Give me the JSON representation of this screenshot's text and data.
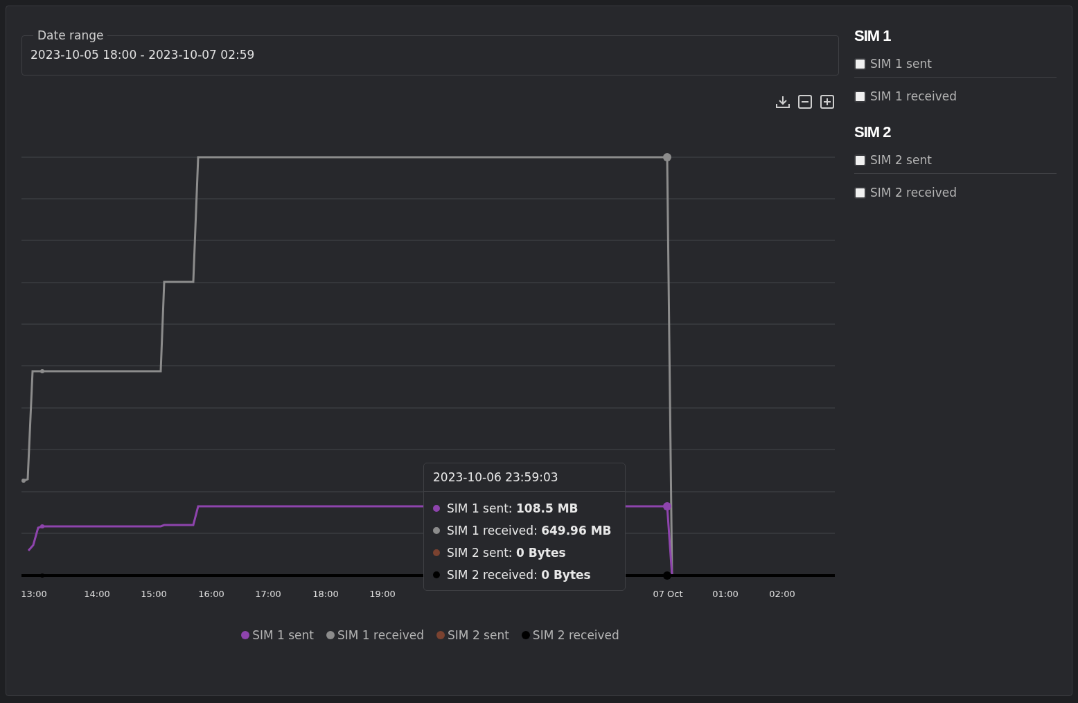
{
  "date_range": {
    "label": "Date range",
    "value": "2023-10-05 18:00 - 2023-10-07 02:59"
  },
  "chart": {
    "x_tick_labels": [
      "13:00",
      "14:00",
      "15:00",
      "16:00",
      "17:00",
      "18:00",
      "19:00",
      "07 Oct",
      "01:00",
      "02:00"
    ]
  },
  "tooltip": {
    "title": "2023-10-06 23:59:03",
    "items": [
      {
        "text": "SIM 1 sent: **108.5 MB**",
        "color": "#8e44ad"
      },
      {
        "text": "SIM 1 received: **649.96 MB**",
        "color": "#8c8c8c"
      },
      {
        "text": "SIM 2 sent: **0 Bytes**",
        "color": "#7a4230"
      },
      {
        "text": "SIM 2 received: **0 Bytes**",
        "color": "#000000"
      }
    ]
  },
  "legend": [
    {
      "label": "SIM 1 sent",
      "color": "#8e44ad"
    },
    {
      "label": "SIM 1 received",
      "color": "#8c8c8c"
    },
    {
      "label": "SIM 2 sent",
      "color": "#7a4230"
    },
    {
      "label": "SIM 2 received",
      "color": "#000000"
    }
  ],
  "sidebar": [
    {
      "title": "SIM 1",
      "options": [
        {
          "label": "SIM 1 sent",
          "checked": false
        },
        {
          "label": "SIM 1 received",
          "checked": false
        }
      ]
    },
    {
      "title": "SIM 2",
      "options": [
        {
          "label": "SIM 2 sent",
          "checked": false
        },
        {
          "label": "SIM 2 received",
          "checked": false
        }
      ]
    }
  ]
}
